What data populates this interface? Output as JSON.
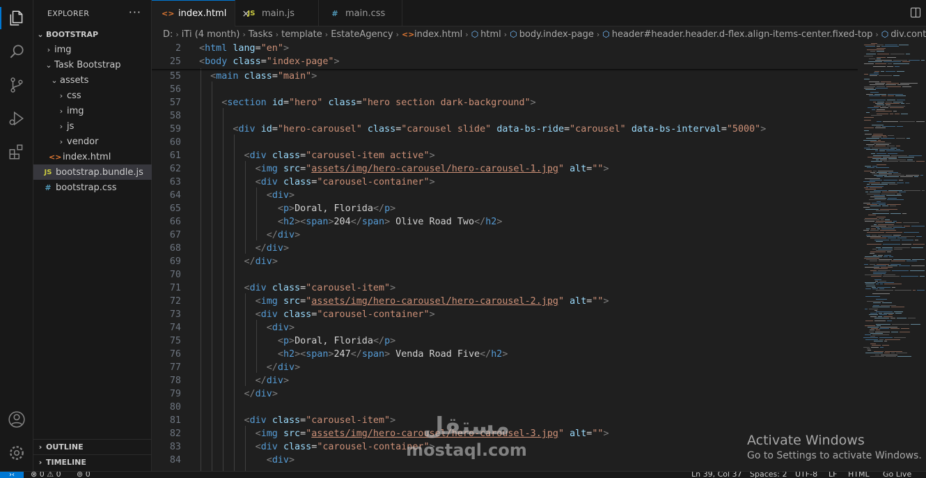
{
  "activitybar": {
    "icons": [
      "explorer-icon",
      "search-icon",
      "source-control-icon",
      "run-debug-icon",
      "extensions-icon",
      "account-icon",
      "settings-gear-icon"
    ]
  },
  "explorer": {
    "title": "EXPLORER",
    "more": "···",
    "root": "BOOTSTRAP",
    "items": {
      "img": "img",
      "task": "Task Bootstrap",
      "assets": "assets",
      "css": "css",
      "img2": "img",
      "js": "js",
      "vendor": "vendor",
      "index": "index.html",
      "bundle": "bootstrap.bundle.js",
      "bcss": "bootstrap.css"
    },
    "outline": "OUTLINE",
    "timeline": "TIMELINE"
  },
  "tabs": [
    {
      "label": "index.html",
      "icon": "<>",
      "close": "×"
    },
    {
      "label": "main.js",
      "icon": "JS"
    },
    {
      "label": "main.css",
      "icon": "#"
    }
  ],
  "breadcrumb": {
    "drive": "D:",
    "c1": "iTi (4 month)",
    "c2": "Tasks",
    "c3": "template",
    "c4": "EstateAgency",
    "c5": "index.html",
    "c6": "html",
    "c7": "body.index-page",
    "c8": "header#header.header.d-flex.align-items-center.fixed-top",
    "c9": "div.container-fluid"
  },
  "code": {
    "l2": "2",
    "l25": "25",
    "l55": "55",
    "l56": "56",
    "l57": "57",
    "l58": "58",
    "l59": "59",
    "l60": "60",
    "l61": "61",
    "l62": "62",
    "l63": "63",
    "l64": "64",
    "l65": "65",
    "l66": "66",
    "l67": "67",
    "l68": "68",
    "l69": "69",
    "l70": "70",
    "l71": "71",
    "l72": "72",
    "l73": "73",
    "l74": "74",
    "l75": "75",
    "l76": "76",
    "l77": "77",
    "l78": "78",
    "l79": "79",
    "l80": "80",
    "l81": "81",
    "l82": "82",
    "l83": "83",
    "l84": "84",
    "html_lang": "\"en\"",
    "body_class": "\"index-page\"",
    "main_class": "\"main\"",
    "hero_id": "\"hero\"",
    "hero_class": "\"hero section dark-background\"",
    "carousel_id": "\"hero-carousel\"",
    "carousel_class": "\"carousel slide\"",
    "ride": "\"carousel\"",
    "interval": "\"5000\"",
    "item_active": "\"carousel-item active\"",
    "item": "\"carousel-item\"",
    "container": "\"carousel-container\"",
    "img1": "assets/img/hero-carousel/hero-carousel-1.jpg",
    "img2": "assets/img/hero-carousel/hero-carousel-2.jpg",
    "img3": "assets/img/hero-carousel/hero-carousel-3.jpg",
    "empty": "\"\"",
    "city": "Doral, Florida",
    "n1": "204",
    "road1": " Olive Road Two",
    "n2": "247",
    "road2": " Venda Road Five"
  },
  "watermark": {
    "arabic": "مستقل",
    "latin": "mostaql.com"
  },
  "activation": {
    "title": "Activate Windows",
    "subtitle": "Go to Settings to activate Windows."
  },
  "statusbar": {
    "problems": "⊗ 0 ⚠ 0",
    "ports": "⊚ 0",
    "position": "Ln 39, Col 37",
    "spaces": "Spaces: 2",
    "encoding": "UTF-8",
    "eol": "LF",
    "language": "HTML",
    "golive": "Go Live"
  },
  "colors": {
    "accent": "#0078d4",
    "tag": "#569cd6",
    "attribute": "#9cdcfe",
    "string": "#ce9178"
  }
}
